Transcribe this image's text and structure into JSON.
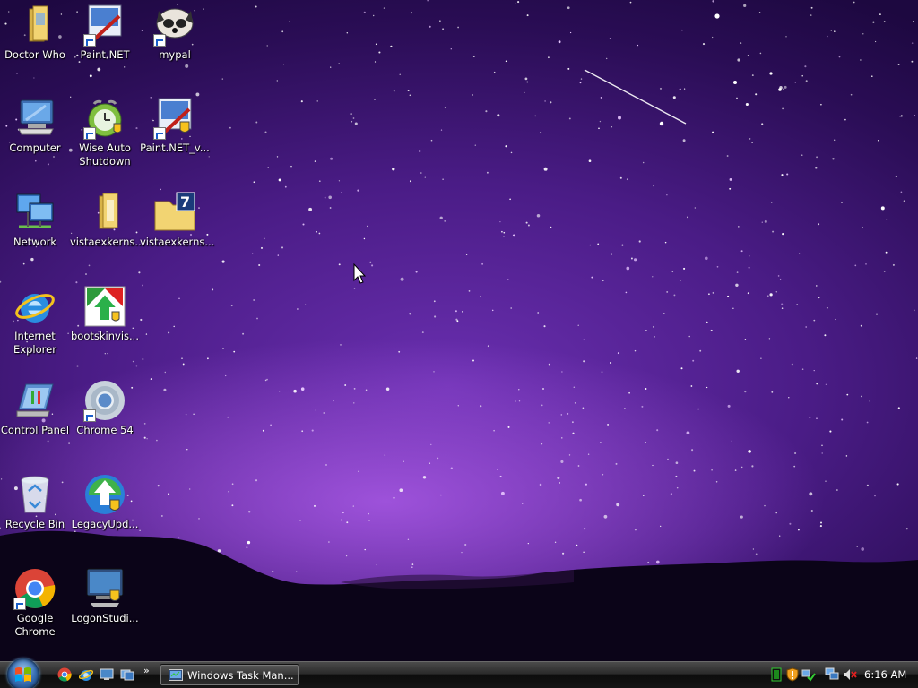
{
  "desktop": {
    "icons": [
      {
        "label": "Doctor Who",
        "icon": "folder-icon"
      },
      {
        "label": "Paint.NET",
        "icon": "paintnet-icon"
      },
      {
        "label": "mypal",
        "icon": "mypal-icon"
      },
      {
        "label": "Computer",
        "icon": "computer-icon"
      },
      {
        "label": "Wise Auto\nShutdown",
        "icon": "wise-auto-shutdown-icon"
      },
      {
        "label": "Paint.NET_v...",
        "icon": "paintnet-installer-icon"
      },
      {
        "label": "Network",
        "icon": "network-icon"
      },
      {
        "label": "vistaexkerns...",
        "icon": "folder-icon"
      },
      {
        "label": "vistaexkerns...",
        "icon": "7zip-archive-icon"
      },
      {
        "label": "Internet\nExplorer",
        "icon": "internet-explorer-icon"
      },
      {
        "label": "bootskinvis...",
        "icon": "bootskin-installer-icon"
      },
      {
        "label": "Control Panel",
        "icon": "control-panel-icon"
      },
      {
        "label": "Chrome 54",
        "icon": "chrome-54-icon"
      },
      {
        "label": "Recycle Bin",
        "icon": "recycle-bin-icon"
      },
      {
        "label": "LegacyUpd...",
        "icon": "legacy-update-icon"
      },
      {
        "label": "Google\nChrome",
        "icon": "chrome-icon"
      },
      {
        "label": "LogonStudi...",
        "icon": "logonstudio-icon"
      }
    ]
  },
  "taskbar": {
    "start_icon": "windows-start-orb-icon",
    "quick_launch": [
      "chrome-icon",
      "internet-explorer-icon",
      "show-desktop-icon",
      "switch-windows-icon"
    ],
    "quick_launch_more": "»",
    "task_button_label": "Windows Task Man...",
    "task_button_icon": "task-manager-icon",
    "tray_icons": [
      "task-manager-cpu-icon",
      "security-shield-icon",
      "network-check-icon",
      "network-icon",
      "volume-muted-icon"
    ],
    "clock": "6:16 AM"
  },
  "colors": {
    "sky_top": "#2a0d55",
    "sky_glow": "#8a45d0",
    "ground": "#0a0418",
    "taskbar": "#1a1a1a"
  }
}
